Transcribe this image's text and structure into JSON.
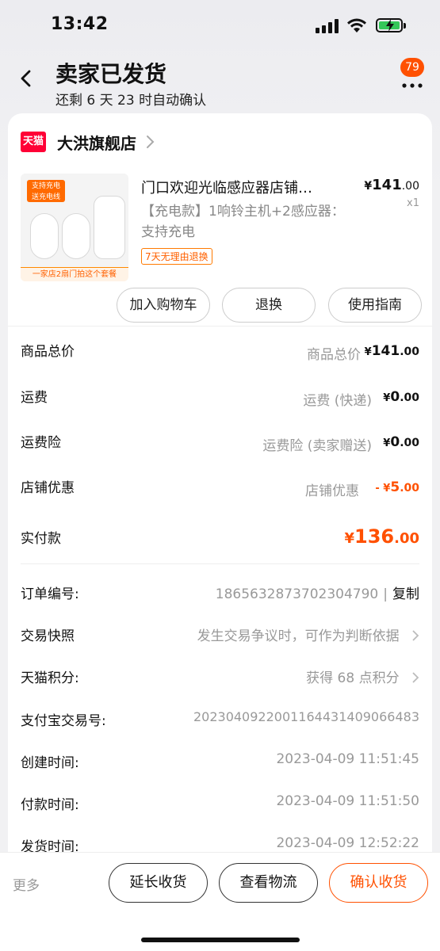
{
  "status_bar": {
    "time": "13:42"
  },
  "header": {
    "title": "卖家已发货",
    "subtitle": "还剩 6 天 23 时自动确认",
    "badge_count": "79"
  },
  "shop": {
    "logo_text": "天猫",
    "name": "大洪旗舰店"
  },
  "product": {
    "image_tag_line1": "支持充电",
    "image_tag_line2": "送充电线",
    "image_bottom_text": "一家店2扇门拍这个套餐",
    "title": "门口欢迎光临感应器店铺…",
    "sku": "【充电款】1响铃主机+2感应器：支持充电",
    "return_tag": "7天无理由退换",
    "price_currency": "¥",
    "price_int": "141",
    "price_dec": ".00",
    "qty": "x1"
  },
  "actions": {
    "add_cart": "加入购物车",
    "return": "退换",
    "guide": "使用指南"
  },
  "summary": {
    "goods_total": {
      "label": "商品总价",
      "desc": "商品总价",
      "currency": "¥",
      "int": "141",
      "dec": ".00"
    },
    "shipping": {
      "label": "运费",
      "desc": "运费 (快递)",
      "currency": "¥",
      "int": "0",
      "dec": ".00"
    },
    "insurance": {
      "label": "运费险",
      "desc": "运费险 (卖家赠送)",
      "currency": "¥",
      "int": "0",
      "dec": ".00"
    },
    "discount": {
      "label": "店铺优惠",
      "desc": "店铺优惠",
      "prefix": "- ¥",
      "int": "5",
      "dec": ".00"
    },
    "paid": {
      "label": "实付款",
      "currency": "¥",
      "int": "136",
      "dec": ".00"
    }
  },
  "order_info": {
    "order_no_label": "订单编号:",
    "order_no": "1865632873702304790",
    "copy": "复制",
    "snapshot_label": "交易快照",
    "snapshot_value": "发生交易争议时，可作为判断依据",
    "points_label": "天猫积分:",
    "points_value": "获得 68 点积分",
    "alipay_label": "支付宝交易号:",
    "alipay_value": "2023040922001164431409066483",
    "created_label": "创建时间:",
    "created_value": "2023-04-09 11:51:45",
    "paid_label": "付款时间:",
    "paid_value": "2023-04-09 11:51:50",
    "shipped_label": "发货时间:",
    "shipped_value": "2023-04-09 12:52:22"
  },
  "bottom_bar": {
    "more": "更多",
    "extend": "延长收货",
    "logistics": "查看物流",
    "confirm": "确认收货"
  },
  "colors": {
    "accent": "#ff5000",
    "tmall": "#ff0036",
    "battery": "#34c759"
  }
}
